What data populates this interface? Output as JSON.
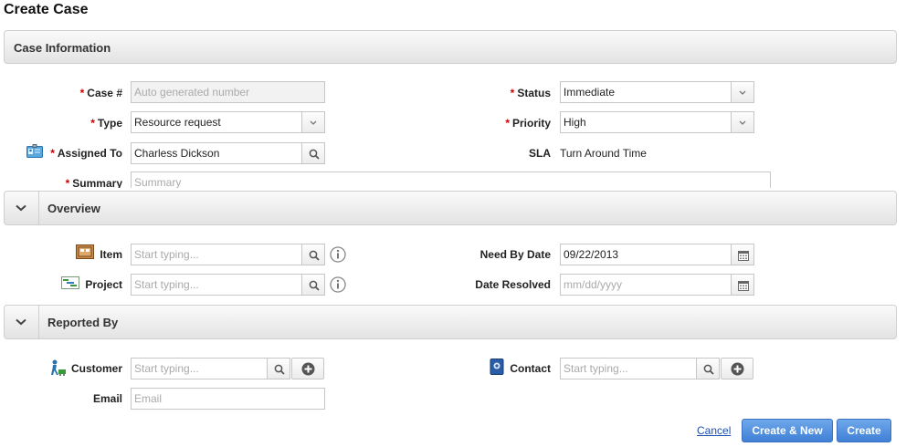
{
  "page": {
    "title": "Create Case"
  },
  "sections": {
    "case_information": "Case Information",
    "overview": "Overview",
    "reported_by": "Reported By"
  },
  "case_info": {
    "case_number": {
      "label": "Case #",
      "placeholder": "Auto generated number"
    },
    "status": {
      "label": "Status",
      "value": "Immediate"
    },
    "type": {
      "label": "Type",
      "value": "Resource request"
    },
    "priority": {
      "label": "Priority",
      "value": "High"
    },
    "assigned_to": {
      "label": "Assigned To",
      "value": "Charless Dickson"
    },
    "sla": {
      "label": "SLA",
      "value": "Turn Around Time"
    },
    "summary": {
      "label": "Summary",
      "placeholder": "Summary"
    }
  },
  "overview": {
    "item": {
      "label": "Item",
      "placeholder": "Start typing..."
    },
    "project": {
      "label": "Project",
      "placeholder": "Start typing..."
    },
    "need_by_date": {
      "label": "Need By Date",
      "value": "09/22/2013"
    },
    "date_resolved": {
      "label": "Date Resolved",
      "placeholder": "mm/dd/yyyy"
    }
  },
  "reported_by": {
    "customer": {
      "label": "Customer",
      "placeholder": "Start typing..."
    },
    "contact": {
      "label": "Contact",
      "placeholder": "Start typing..."
    },
    "email": {
      "label": "Email",
      "placeholder": "Email"
    }
  },
  "actions": {
    "cancel": "Cancel",
    "create_new": "Create & New",
    "create": "Create"
  },
  "required_marker": "*",
  "colors": {
    "accent": "#3f7fd6",
    "required": "#cc0000",
    "link": "#1b4fb3"
  },
  "icons": [
    "assigned-to-icon",
    "item-icon",
    "project-icon",
    "customer-icon",
    "contact-icon",
    "search-icon",
    "calendar-icon",
    "info-icon",
    "add-icon",
    "chevron-down-icon"
  ]
}
